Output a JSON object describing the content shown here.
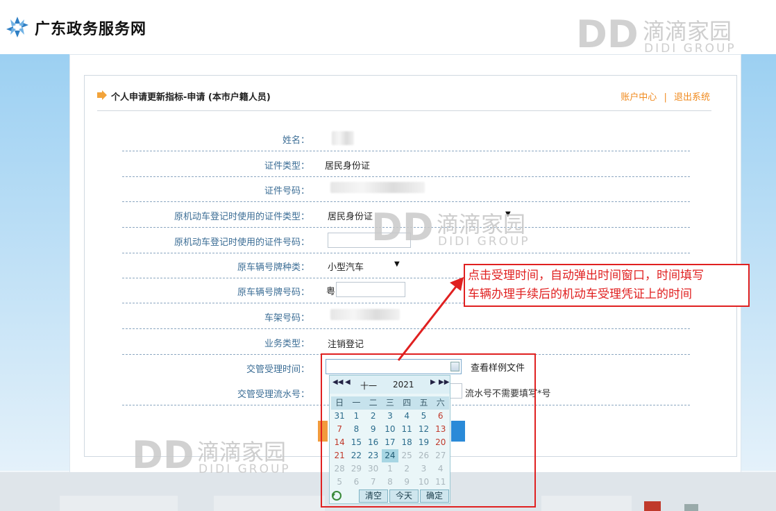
{
  "header": {
    "site_title": "广东政务服务网"
  },
  "watermark": {
    "mark": "DD",
    "cn": "滴滴家园",
    "en": "DIDI GROUP"
  },
  "panel": {
    "title": "个人申请更新指标-申请 (本市户籍人员)",
    "links": {
      "account": "账户中心",
      "separator": "|",
      "logout": "退出系统"
    }
  },
  "form": {
    "rows": [
      {
        "label": "姓名：",
        "value": ""
      },
      {
        "label": "证件类型：",
        "value": "居民身份证"
      },
      {
        "label": "证件号码：",
        "value": ""
      },
      {
        "label": "原机动车登记时使用的证件类型：",
        "value": "居民身份证"
      },
      {
        "label": "原机动车登记时使用的证件号码：",
        "value": ""
      },
      {
        "label": "原车辆号牌种类：",
        "value": "小型汽车"
      },
      {
        "label": "原车辆号牌号码：",
        "value": "粤"
      },
      {
        "label": "车架号码：",
        "value": ""
      },
      {
        "label": "业务类型：",
        "value": "注销登记"
      },
      {
        "label": "交管受理时间：",
        "value": ""
      },
      {
        "label": "交管受理流水号：",
        "value": ""
      }
    ],
    "sample_link": "查看样例文件",
    "serial_hint": "流水号不需要填写*号"
  },
  "calendar": {
    "month": "十一",
    "year": "2021",
    "weekdays": [
      "日",
      "一",
      "二",
      "三",
      "四",
      "五",
      "六"
    ],
    "weeks": [
      [
        "31",
        "1",
        "2",
        "3",
        "4",
        "5",
        "6"
      ],
      [
        "7",
        "8",
        "9",
        "10",
        "11",
        "12",
        "13"
      ],
      [
        "14",
        "15",
        "16",
        "17",
        "18",
        "19",
        "20"
      ],
      [
        "21",
        "22",
        "23",
        "24",
        "25",
        "26",
        "27"
      ],
      [
        "28",
        "29",
        "30",
        "1",
        "2",
        "3",
        "4"
      ],
      [
        "5",
        "6",
        "7",
        "8",
        "9",
        "10",
        "11"
      ]
    ],
    "buttons": {
      "clear": "清空",
      "today": "今天",
      "ok": "确定"
    }
  },
  "callout": {
    "line1": "点击受理时间，自动弹出时间窗口，时间填写",
    "line2": "车辆办理手续后的机动车受理凭证上的时间"
  },
  "colors": {
    "accent_orange": "#f08a1e",
    "label_blue": "#3b6d95",
    "annotation_red": "#e02020"
  }
}
